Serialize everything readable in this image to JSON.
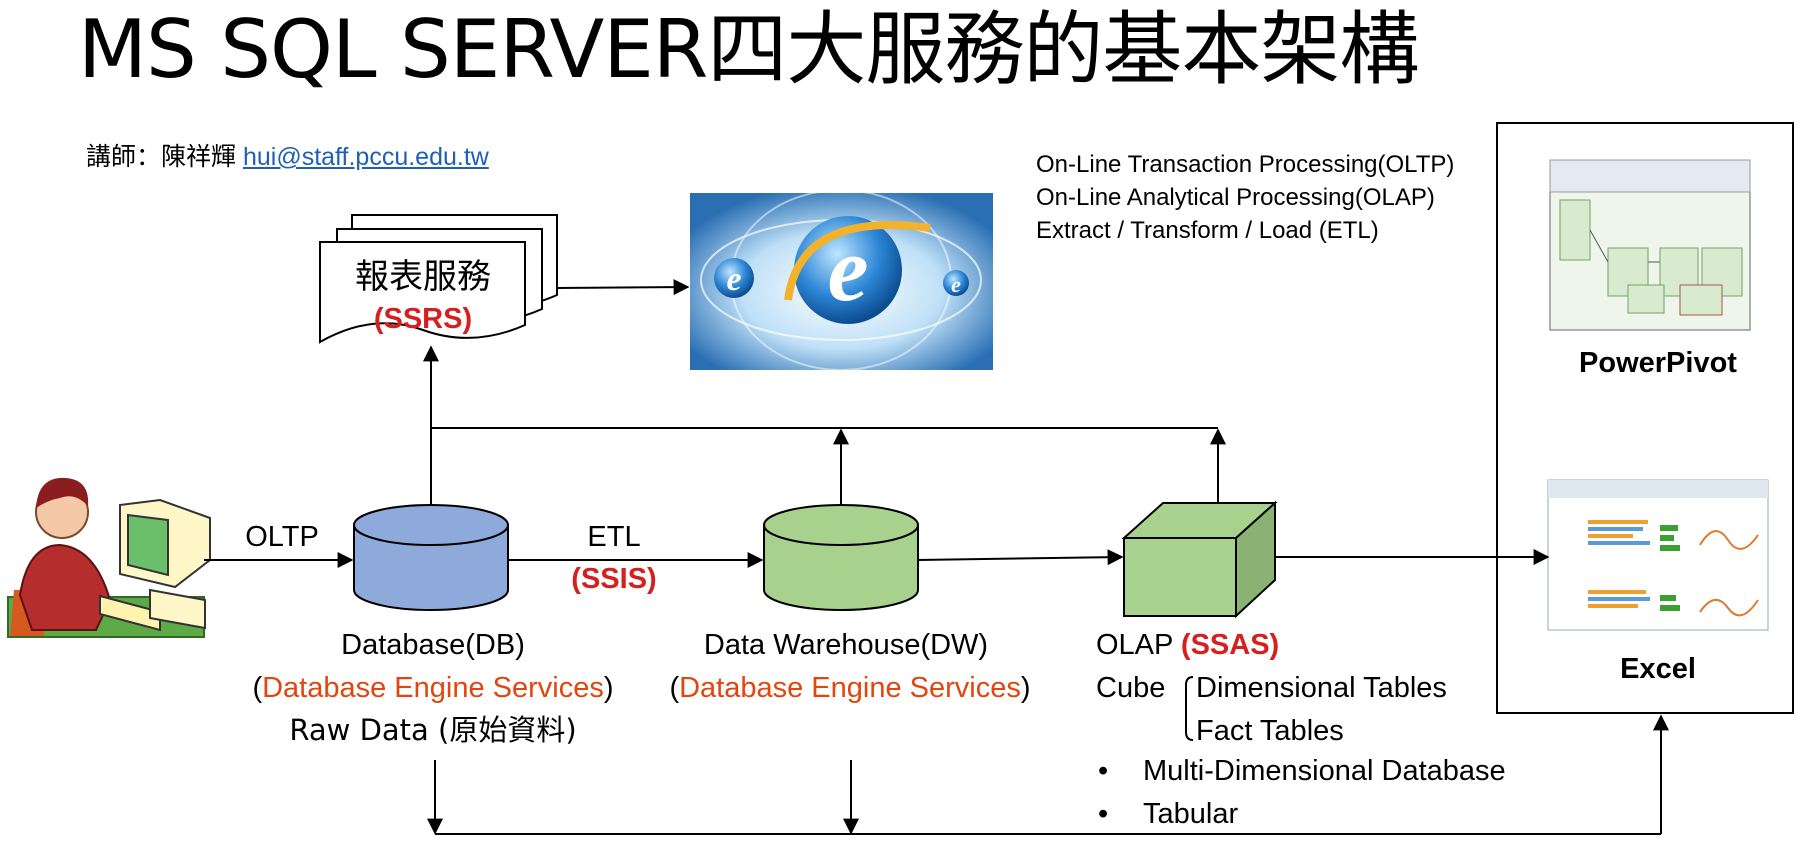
{
  "title": "MS SQL SERVER四大服務的基本架構",
  "lecturer": {
    "label": "講師：陳祥輝 ",
    "email": "hui@staff.pccu.edu.tw"
  },
  "definitions": [
    "On-Line Transaction Processing(OLTP)",
    "On-Line Analytical Processing(OLAP)",
    "Extract / Transform / Load (ETL)"
  ],
  "reports": {
    "label": "報表服務",
    "code": "(SSRS)"
  },
  "flow": {
    "oltp": "OLTP",
    "etl": "ETL",
    "ssis": "(SSIS)"
  },
  "database": {
    "title": "Database(DB)",
    "open_paren": "(",
    "engine": "Database Engine Services",
    "close_paren": ")",
    "raw": "Raw Data (原始資料)"
  },
  "warehouse": {
    "title": "Data Warehouse(DW)",
    "open_paren": "(",
    "engine": "Database Engine Services",
    "close_paren": ")"
  },
  "olap": {
    "label": "OLAP ",
    "code": "(SSAS)",
    "cube": "Cube",
    "tables": [
      "Dimensional Tables",
      "Fact Tables"
    ],
    "bullets": [
      "Multi-Dimensional Database",
      "Tabular"
    ],
    "bullet_glyph": "•"
  },
  "clients": {
    "powerpivot": "PowerPivot",
    "excel": "Excel"
  },
  "colors": {
    "db": "#8eaadb",
    "green": "#a9d18e",
    "green_dark": "#8bb272",
    "red": "#d62020",
    "orange": "#e2460f",
    "link": "#1f5fb8"
  }
}
